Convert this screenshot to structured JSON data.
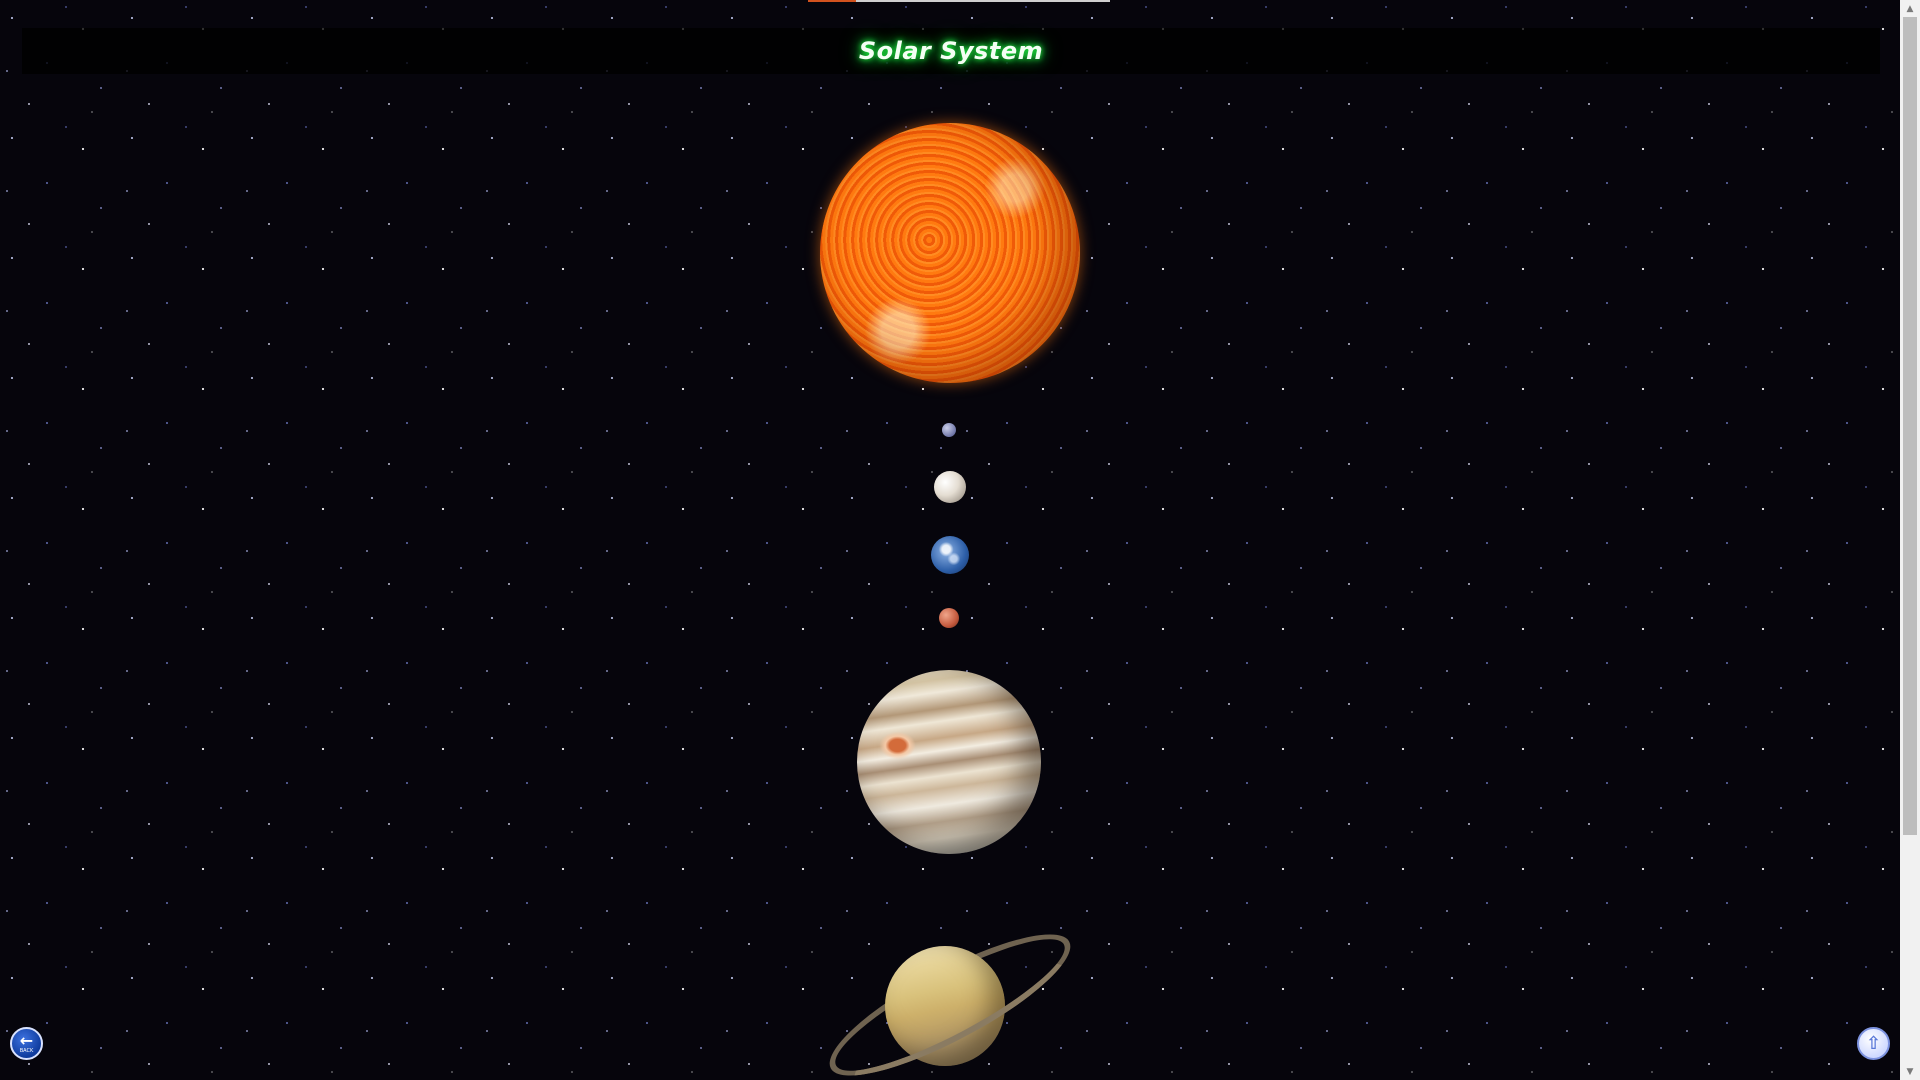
{
  "page": {
    "title": "Solar System"
  },
  "progress": {
    "fraction": 0.16
  },
  "planets": [
    {
      "name": "sun"
    },
    {
      "name": "mercury"
    },
    {
      "name": "venus"
    },
    {
      "name": "earth"
    },
    {
      "name": "mars"
    },
    {
      "name": "jupiter"
    },
    {
      "name": "saturn"
    }
  ],
  "controls": {
    "back_label": "BACK",
    "back_icon": "left-arrow-icon",
    "top_icon": "up-arrow-icon"
  },
  "colors": {
    "title_glow": "#22ff44",
    "background": "#06050c",
    "progress_fill": "#d2521e"
  }
}
